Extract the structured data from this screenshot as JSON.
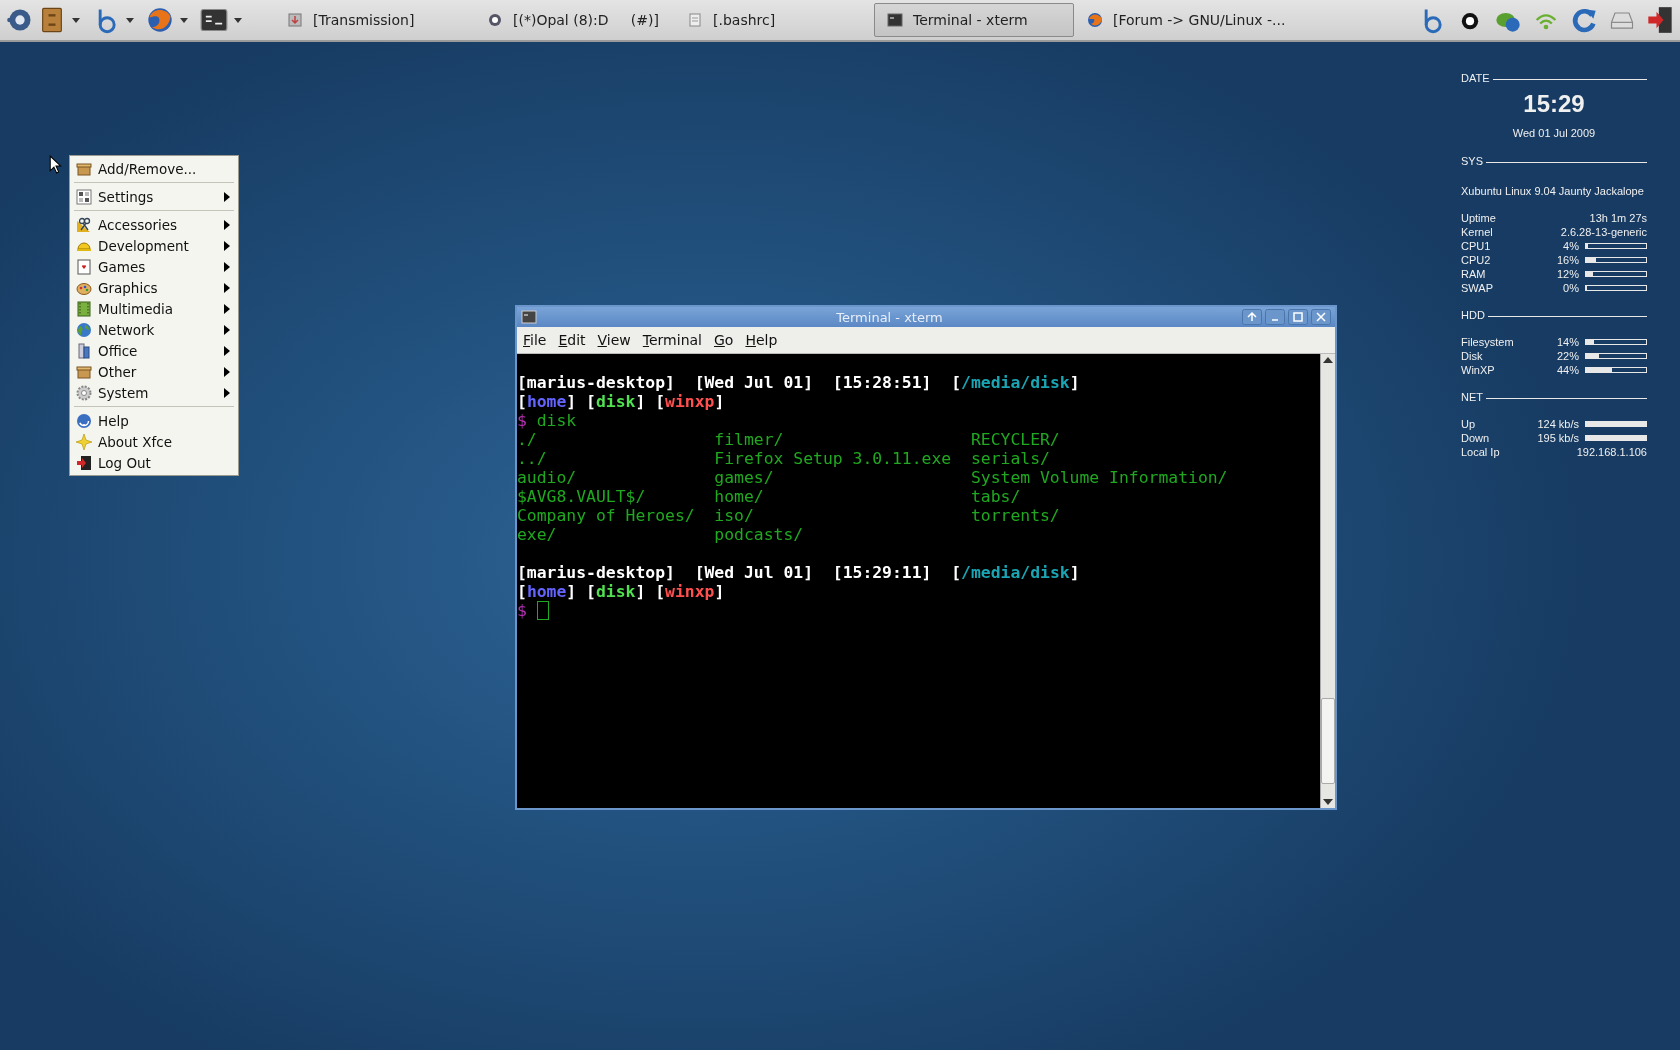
{
  "panel": {
    "tasks": [
      {
        "label": "[Transmission]",
        "selected": false
      },
      {
        "label": "[(*)Opal (8):D     (#)]",
        "selected": false
      },
      {
        "label": "[.bashrc]",
        "selected": false
      },
      {
        "label": "Terminal - xterm",
        "selected": true
      },
      {
        "label": "[Forum -> GNU/Linux -...",
        "selected": false
      }
    ]
  },
  "menu": {
    "sections": [
      [
        {
          "label": "Add/Remove...",
          "submenu": false
        }
      ],
      [
        {
          "label": "Settings",
          "submenu": true
        }
      ],
      [
        {
          "label": "Accessories",
          "submenu": true
        },
        {
          "label": "Development",
          "submenu": true
        },
        {
          "label": "Games",
          "submenu": true
        },
        {
          "label": "Graphics",
          "submenu": true
        },
        {
          "label": "Multimedia",
          "submenu": true
        },
        {
          "label": "Network",
          "submenu": true
        },
        {
          "label": "Office",
          "submenu": true
        },
        {
          "label": "Other",
          "submenu": true
        },
        {
          "label": "System",
          "submenu": true
        }
      ],
      [
        {
          "label": "Help",
          "submenu": false
        },
        {
          "label": "About Xfce",
          "submenu": false
        },
        {
          "label": "Log Out",
          "submenu": false
        }
      ]
    ]
  },
  "conky": {
    "date_heading": "DATE",
    "time": "15:29",
    "day": "Wed 01 Jul 2009",
    "sections": [
      {
        "heading": "SYS",
        "note": "Xubuntu Linux 9.04 Jaunty Jackalope",
        "rows": [
          {
            "kind": "text",
            "label": "Uptime",
            "value": "13h 1m 27s"
          },
          {
            "kind": "text",
            "label": "Kernel",
            "value": "2.6.28-13-generic"
          },
          {
            "kind": "bar",
            "label": "CPU1",
            "value": "4%",
            "level": 0.04
          },
          {
            "kind": "bar",
            "label": "CPU2",
            "value": "16%",
            "level": 0.16
          },
          {
            "kind": "bar",
            "label": "RAM",
            "value": "12%",
            "level": 0.12
          },
          {
            "kind": "bar",
            "label": "SWAP",
            "value": "0%",
            "level": 0
          }
        ]
      },
      {
        "heading": "HDD",
        "rows": [
          {
            "kind": "bar",
            "label": "Filesystem",
            "value": "14%",
            "level": 0.14
          },
          {
            "kind": "bar",
            "label": "Disk",
            "value": "22%",
            "level": 0.22
          },
          {
            "kind": "bar",
            "label": "WinXP",
            "value": "44%",
            "level": 0.44
          }
        ]
      },
      {
        "heading": "NET",
        "rows": [
          {
            "kind": "bar",
            "label": "Up",
            "value": "124 kb/s",
            "level": 1
          },
          {
            "kind": "bar",
            "label": "Down",
            "value": "195 kb/s",
            "level": 1
          },
          {
            "kind": "text",
            "label": "Local Ip",
            "value": "192.168.1.106"
          }
        ]
      }
    ]
  },
  "terminal": {
    "title": "Terminal - xterm",
    "menu": [
      "File",
      "Edit",
      "View",
      "Terminal",
      "Go",
      "Help"
    ],
    "lines": [
      {
        "kind": "prompt",
        "fields": [
          {
            "parts": [
              {
                "text": "[marius-desktop]",
                "color": "#ffffff"
              }
            ]
          },
          {
            "parts": [
              {
                "text": "[Wed Jul 01]",
                "color": "#ffffff"
              }
            ]
          },
          {
            "parts": [
              {
                "text": "[15:28:51]",
                "color": "#ffffff"
              }
            ]
          },
          {
            "parts": [
              {
                "text": "[",
                "color": "#ffffff"
              },
              {
                "text": "/media/disk",
                "color": "#1aa5b4"
              },
              {
                "text": "]",
                "color": "#ffffff"
              }
            ]
          }
        ]
      },
      {
        "kind": "tags",
        "fields": [
          {
            "parts": [
              {
                "text": "[",
                "color": "#ffffff"
              },
              {
                "text": "home",
                "color": "#6464ff"
              },
              {
                "text": "]",
                "color": "#ffffff"
              }
            ]
          },
          {
            "parts": [
              {
                "text": "[",
                "color": "#ffffff"
              },
              {
                "text": "disk",
                "color": "#50e050"
              },
              {
                "text": "]",
                "color": "#ffffff"
              }
            ]
          },
          {
            "parts": [
              {
                "text": "[",
                "color": "#ffffff"
              },
              {
                "text": "winxp",
                "color": "#ff5050"
              },
              {
                "text": "]",
                "color": "#ffffff"
              }
            ]
          }
        ]
      },
      {
        "kind": "command",
        "fields": [
          {
            "parts": [
              {
                "text": "$",
                "color": "#b030b0"
              }
            ]
          },
          {
            "parts": [
              {
                "text": "disk",
                "color": "#20a820"
              }
            ]
          }
        ]
      },
      {
        "kind": "listing",
        "cells": [
          "./",
          "filmer/",
          "RECYCLER/"
        ]
      },
      {
        "kind": "listing",
        "cells": [
          "../",
          "Firefox Setup 3.0.11.exe",
          "serials/"
        ]
      },
      {
        "kind": "listing",
        "cells": [
          "audio/",
          "games/",
          "System Volume Information/"
        ]
      },
      {
        "kind": "listing",
        "cells": [
          "$AVG8.VAULT$/",
          "home/",
          "tabs/"
        ]
      },
      {
        "kind": "listing",
        "cells": [
          "Company of Heroes/",
          "iso/",
          "torrents/"
        ]
      },
      {
        "kind": "listing",
        "cells": [
          "exe/",
          "podcasts/"
        ]
      },
      {
        "kind": "blank"
      },
      {
        "kind": "prompt",
        "fields": [
          {
            "parts": [
              {
                "text": "[marius-desktop]",
                "color": "#ffffff"
              }
            ]
          },
          {
            "parts": [
              {
                "text": "[Wed Jul 01]",
                "color": "#ffffff"
              }
            ]
          },
          {
            "parts": [
              {
                "text": "[15:29:11]",
                "color": "#ffffff"
              }
            ]
          },
          {
            "parts": [
              {
                "text": "[",
                "color": "#ffffff"
              },
              {
                "text": "/media/disk",
                "color": "#1aa5b4"
              },
              {
                "text": "]",
                "color": "#ffffff"
              }
            ]
          }
        ]
      },
      {
        "kind": "tags",
        "fields": [
          {
            "parts": [
              {
                "text": "[",
                "color": "#ffffff"
              },
              {
                "text": "home",
                "color": "#6464ff"
              },
              {
                "text": "]",
                "color": "#ffffff"
              }
            ]
          },
          {
            "parts": [
              {
                "text": "[",
                "color": "#ffffff"
              },
              {
                "text": "disk",
                "color": "#50e050"
              },
              {
                "text": "]",
                "color": "#ffffff"
              }
            ]
          },
          {
            "parts": [
              {
                "text": "[",
                "color": "#ffffff"
              },
              {
                "text": "winxp",
                "color": "#ff5050"
              },
              {
                "text": "]",
                "color": "#ffffff"
              }
            ]
          }
        ]
      },
      {
        "kind": "cursor",
        "fields": [
          {
            "parts": [
              {
                "text": "$",
                "color": "#b030b0"
              }
            ]
          }
        ]
      }
    ]
  }
}
